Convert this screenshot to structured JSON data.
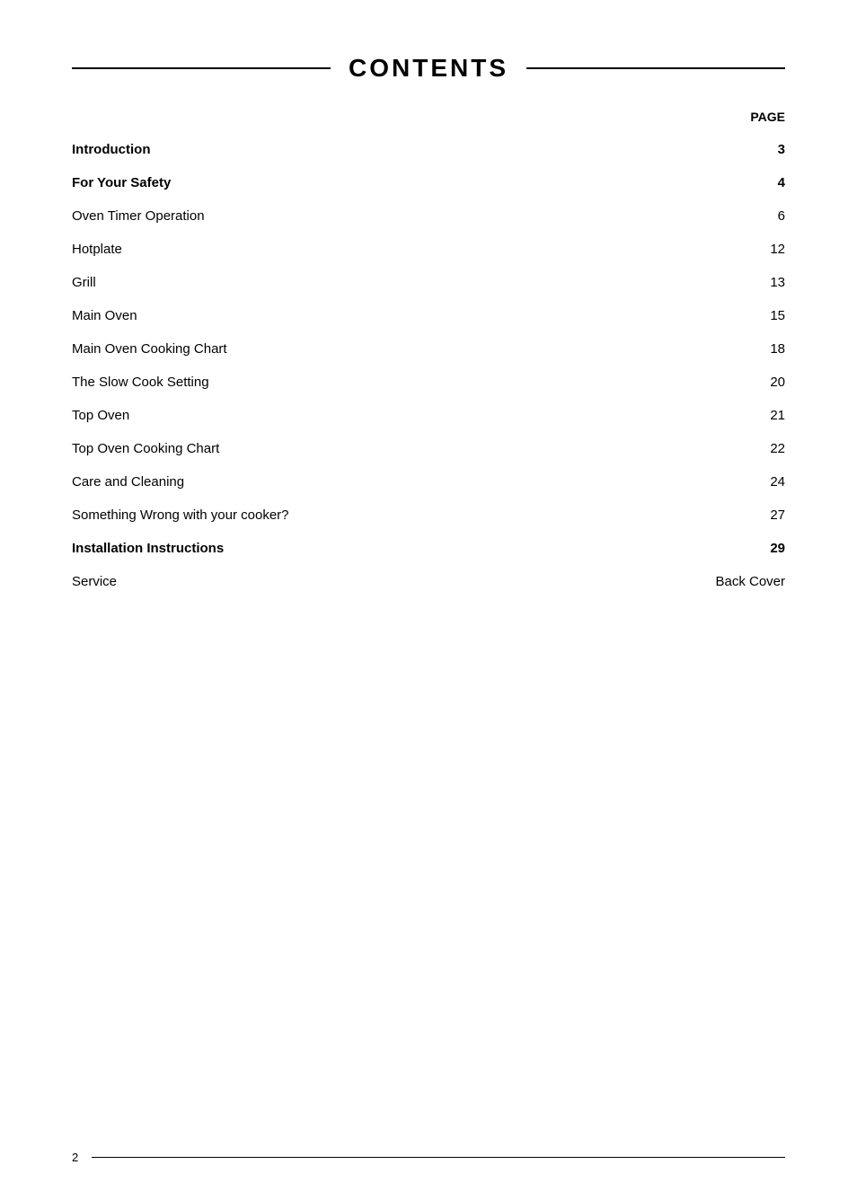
{
  "header": {
    "title": "CONTENTS",
    "page_column_label": "PAGE"
  },
  "toc": [
    {
      "id": "introduction",
      "label": "Introduction",
      "page": "3",
      "bold": true
    },
    {
      "id": "for-your-safety",
      "label": "For Your Safety",
      "page": "4",
      "bold": true
    },
    {
      "id": "oven-timer-operation",
      "label": "Oven Timer Operation",
      "page": "6",
      "bold": false
    },
    {
      "id": "hotplate",
      "label": "Hotplate",
      "page": "12",
      "bold": false
    },
    {
      "id": "grill",
      "label": "Grill",
      "page": "13",
      "bold": false
    },
    {
      "id": "main-oven",
      "label": "Main Oven",
      "page": "15",
      "bold": false
    },
    {
      "id": "main-oven-cooking-chart",
      "label": "Main Oven Cooking Chart",
      "page": "18",
      "bold": false
    },
    {
      "id": "slow-cook-setting",
      "label": "The Slow Cook Setting",
      "page": "20",
      "bold": false
    },
    {
      "id": "top-oven",
      "label": "Top Oven",
      "page": "21",
      "bold": false
    },
    {
      "id": "top-oven-cooking-chart",
      "label": "Top Oven Cooking Chart",
      "page": "22",
      "bold": false
    },
    {
      "id": "care-and-cleaning",
      "label": "Care and Cleaning",
      "page": "24",
      "bold": false
    },
    {
      "id": "something-wrong",
      "label": "Something Wrong with your cooker?",
      "page": "27",
      "bold": false
    },
    {
      "id": "installation-instructions",
      "label": "Installation Instructions",
      "page": "29",
      "bold": true
    },
    {
      "id": "service",
      "label": "Service",
      "page": "Back Cover",
      "bold": false
    }
  ],
  "footer": {
    "page_number": "2"
  }
}
